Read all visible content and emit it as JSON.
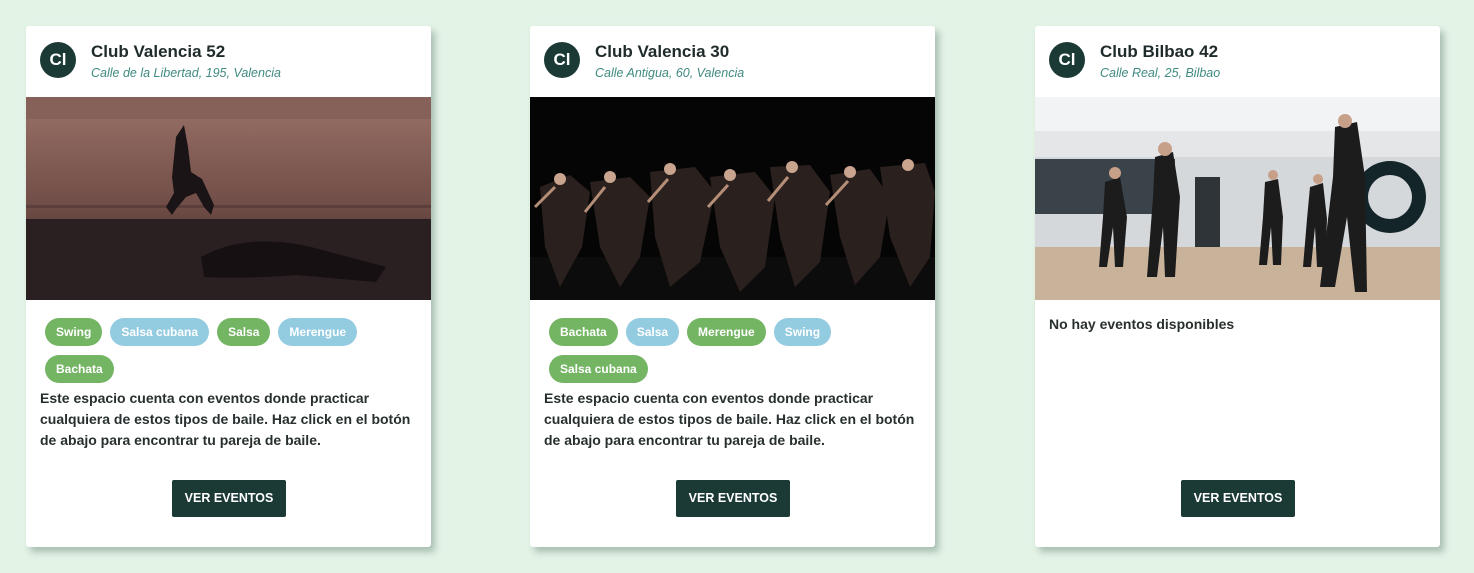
{
  "cards": [
    {
      "avatar": "Cl",
      "title": "Club Valencia 52",
      "address": "Calle de la Libertad, 195, Valencia",
      "image_icon": "dancer-ballet-photo",
      "tags": [
        {
          "label": "Swing",
          "color": "#74b564"
        },
        {
          "label": "Salsa cubana",
          "color": "#93cbe0"
        },
        {
          "label": "Salsa",
          "color": "#74b564"
        },
        {
          "label": "Merengue",
          "color": "#93cbe0"
        },
        {
          "label": "Bachata",
          "color": "#74b564"
        }
      ],
      "description": "Este espacio cuenta con eventos donde practicar cualquiera de estos tipos de baile. Haz click en el botón de abajo para encontrar tu pareja de baile.",
      "button": "VER EVENTOS"
    },
    {
      "avatar": "Cl",
      "title": "Club Valencia 30",
      "address": "Calle Antigua, 60, Valencia",
      "image_icon": "dance-troupe-stage-photo",
      "tags": [
        {
          "label": "Bachata",
          "color": "#74b564"
        },
        {
          "label": "Salsa",
          "color": "#93cbe0"
        },
        {
          "label": "Merengue",
          "color": "#74b564"
        },
        {
          "label": "Swing",
          "color": "#93cbe0"
        },
        {
          "label": "Salsa cubana",
          "color": "#74b564"
        }
      ],
      "description": "Este espacio cuenta con eventos donde practicar cualquiera de estos tipos de baile. Haz click en el botón de abajo para encontrar tu pareja de baile.",
      "button": "VER EVENTOS"
    },
    {
      "avatar": "Cl",
      "title": "Club Bilbao 42",
      "address": "Calle Real, 25, Bilbao",
      "image_icon": "dance-studio-class-photo",
      "empty_message": "No hay eventos disponibles",
      "button": "VER EVENTOS"
    }
  ],
  "colors": {
    "page_background": "#e3f3e6",
    "accent_dark": "#1b3a36",
    "address_text": "#3f8a80",
    "tag_green": "#74b564",
    "tag_blue": "#93cbe0"
  }
}
